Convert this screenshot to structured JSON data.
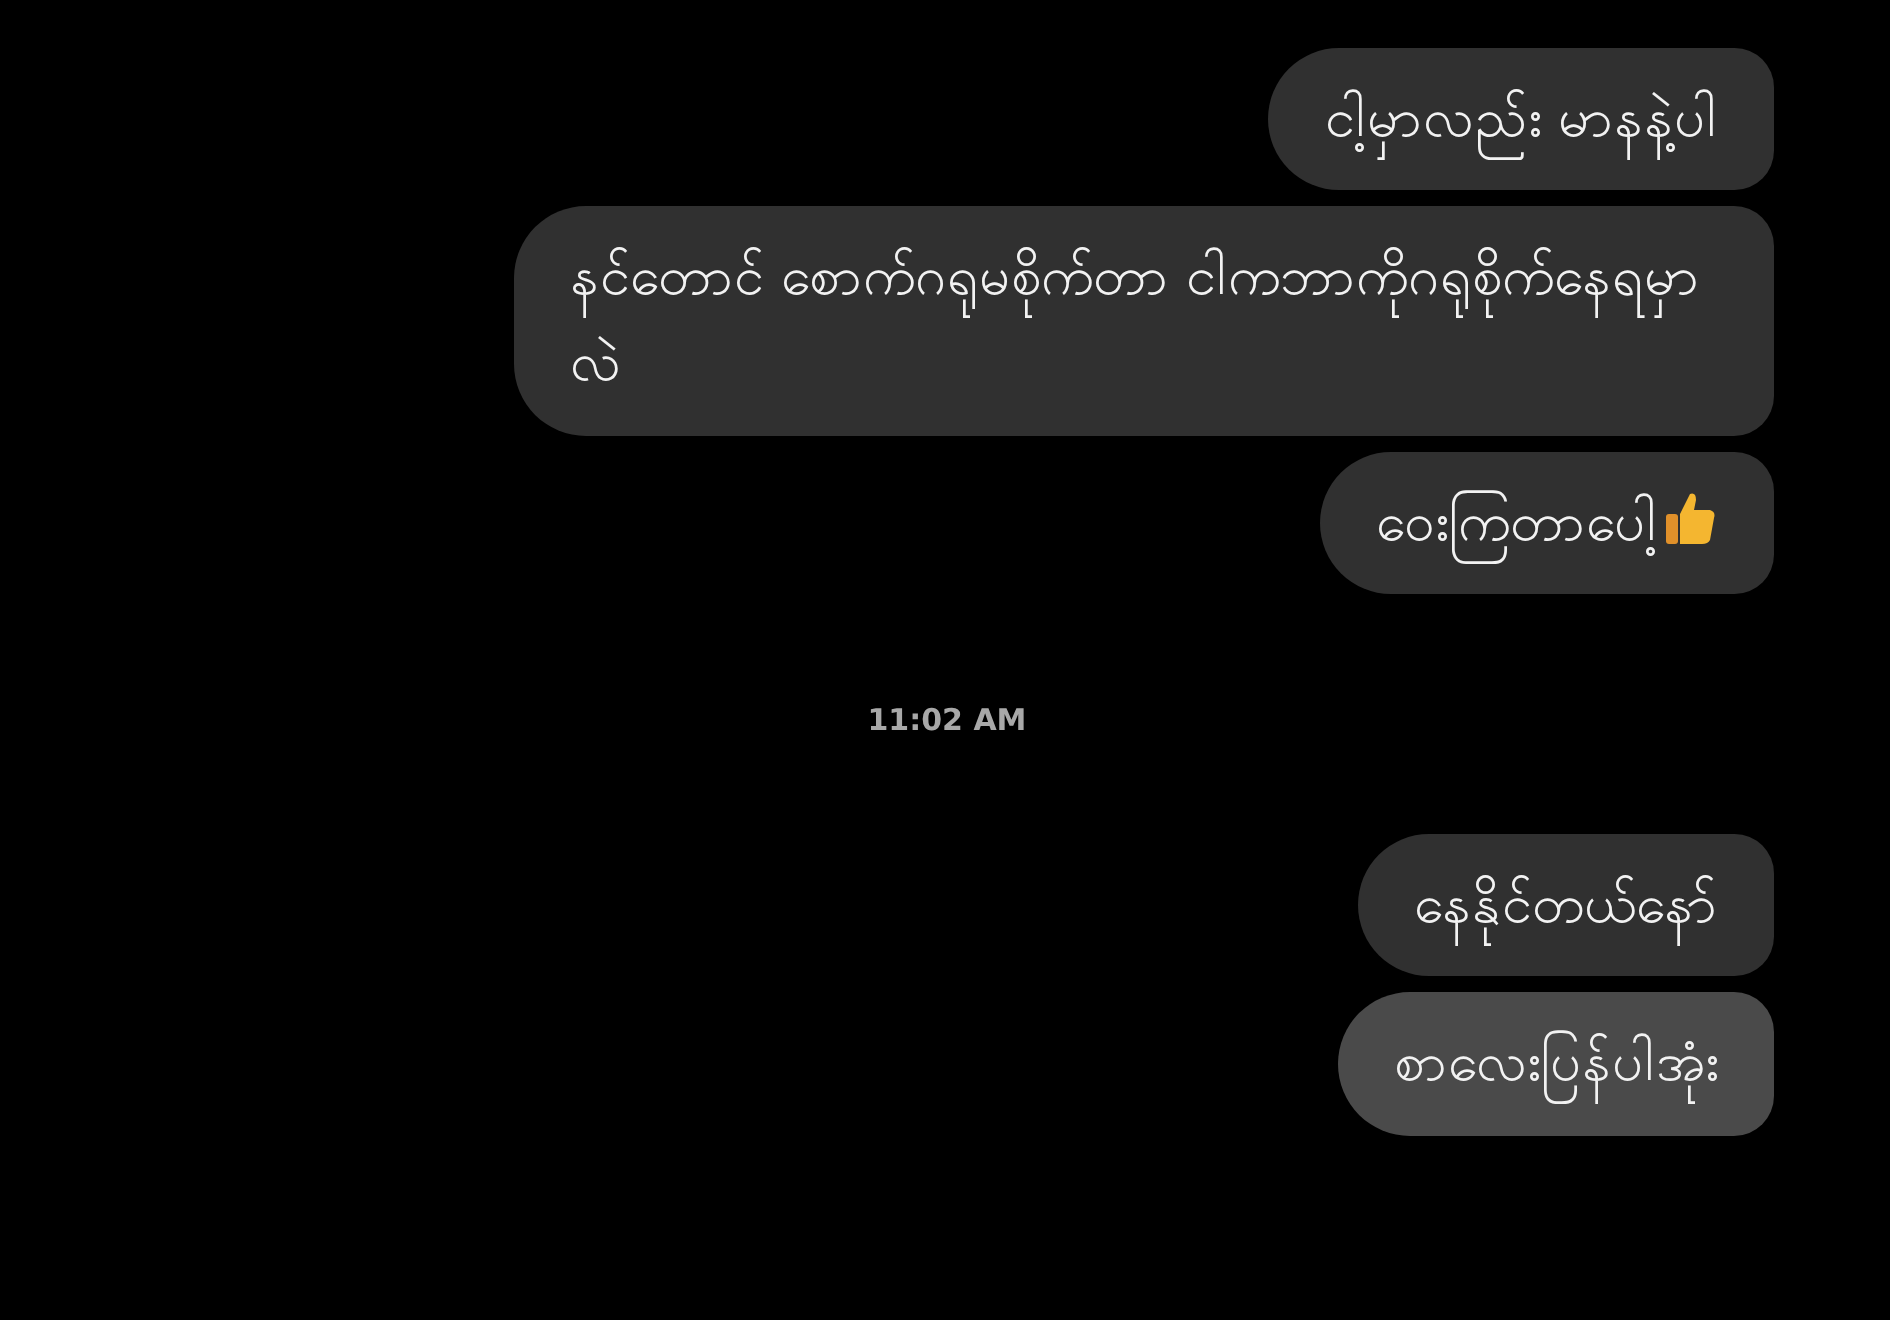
{
  "messages": [
    {
      "kind": "message",
      "text": "ငါ့မှာလည်း မာနနဲ့ပါ",
      "highlighted": false
    },
    {
      "kind": "message",
      "text": "နင်တောင် စောက်ဂရုမစိုက်တာ ငါကဘာကိုဂရုစိုက်နေရမှာလဲ",
      "highlighted": false
    },
    {
      "kind": "message",
      "text": "ဝေးကြတာပေါ့",
      "thumbs_up": true,
      "highlighted": false
    },
    {
      "kind": "time",
      "text": "11:02 AM"
    },
    {
      "kind": "message",
      "text": "နေနိုင်တယ်နော်",
      "highlighted": false
    },
    {
      "kind": "message",
      "text": "စာလေးပြန်ပါအုံး",
      "highlighted": true
    }
  ]
}
